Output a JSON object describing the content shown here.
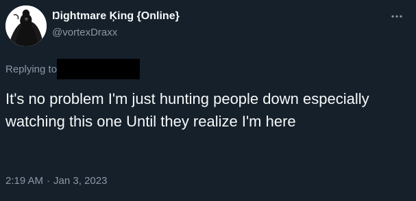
{
  "theme": {
    "background": "#15202b",
    "text_primary": "#f7f9f9",
    "text_secondary": "#8b98a5"
  },
  "author": {
    "display_name": "Ŋightmare Ķing {Online}",
    "handle": "@vortexDraxx",
    "avatar_icon": "dark-figure-avatar"
  },
  "header": {
    "more_icon": "more-horizontal-icon"
  },
  "reply": {
    "prefix": "Replying to"
  },
  "tweet": {
    "text": "It's no problem I'm just hunting people down especially watching this one Until they realize I'm here"
  },
  "meta": {
    "time": "2:19 AM",
    "separator": "·",
    "date": "Jan 3, 2023"
  }
}
